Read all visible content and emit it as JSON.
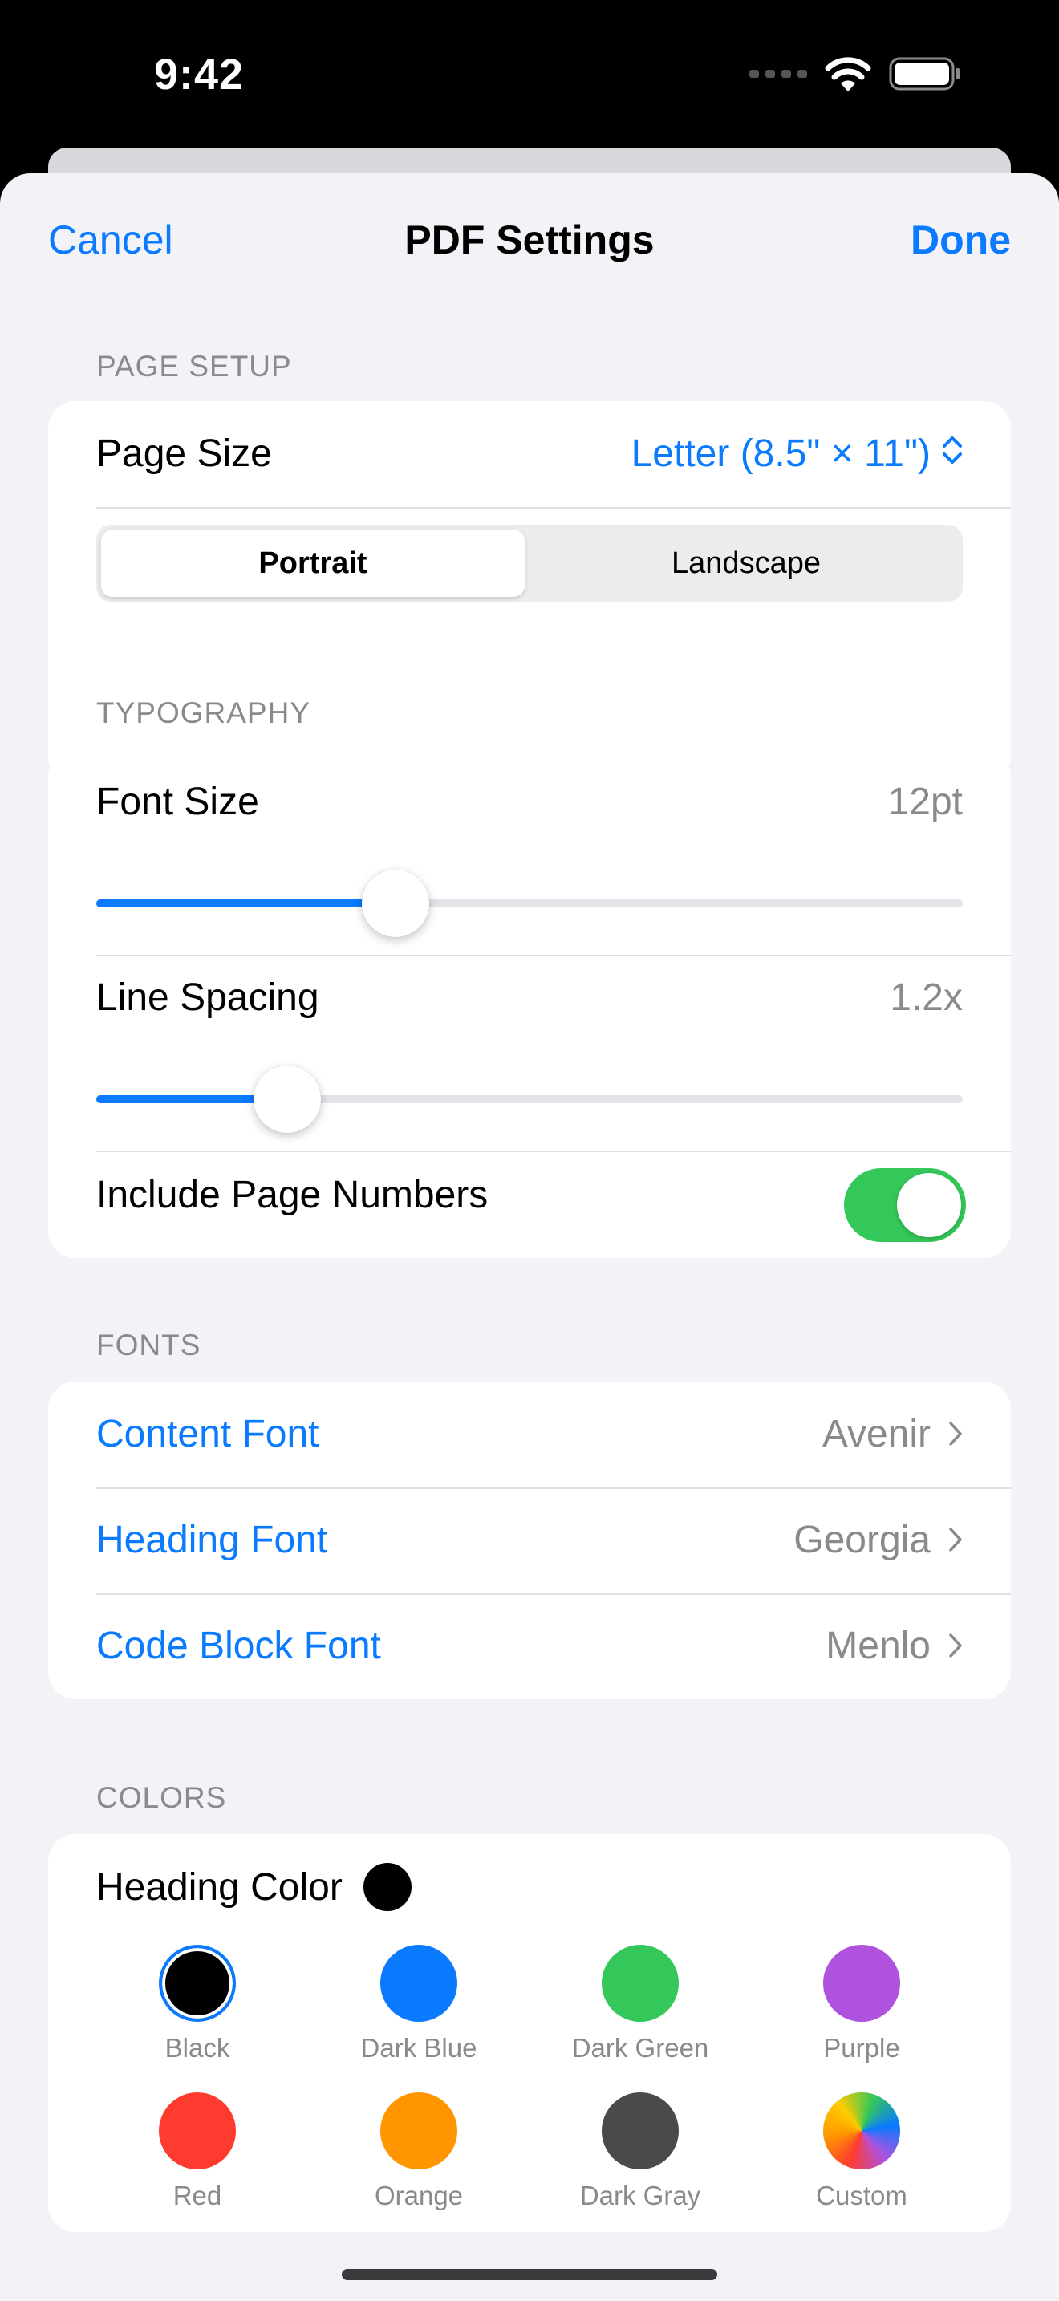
{
  "status_bar": {
    "time": "9:42"
  },
  "nav": {
    "cancel": "Cancel",
    "title": "PDF Settings",
    "done": "Done"
  },
  "page_setup": {
    "header": "PAGE SETUP",
    "page_size_label": "Page Size",
    "page_size_value": "Letter (8.5\" × 11\")",
    "orientation_options": [
      "Portrait",
      "Landscape"
    ],
    "selected_orientation": "Portrait"
  },
  "typography": {
    "header": "TYPOGRAPHY",
    "font_size_label": "Font Size",
    "font_size_value": "12pt",
    "font_size_fraction": 0.345,
    "line_spacing_label": "Line Spacing",
    "line_spacing_value": "1.2x",
    "line_spacing_fraction": 0.22,
    "page_numbers_label": "Include Page Numbers",
    "page_numbers_on": true
  },
  "fonts": {
    "header": "FONTS",
    "items": [
      {
        "label": "Content Font",
        "value": "Avenir"
      },
      {
        "label": "Heading Font",
        "value": "Georgia"
      },
      {
        "label": "Code Block Font",
        "value": "Menlo"
      }
    ]
  },
  "colors": {
    "header": "COLORS",
    "heading_color_label": "Heading Color",
    "current_color": "#000000",
    "selected": "Black",
    "options": [
      {
        "name": "Black",
        "color": "#000000"
      },
      {
        "name": "Dark Blue",
        "color": "#0a7aff"
      },
      {
        "name": "Dark Green",
        "color": "#34c759"
      },
      {
        "name": "Purple",
        "color": "#af52de"
      },
      {
        "name": "Red",
        "color": "#ff3b30"
      },
      {
        "name": "Orange",
        "color": "#ff9500"
      },
      {
        "name": "Dark Gray",
        "color": "#4a4a4a"
      },
      {
        "name": "Custom",
        "color": "conic-gradient"
      }
    ]
  },
  "theme": {
    "accent": "#0a7aff",
    "toggle_on": "#34c759",
    "secondary_text": "#8a8a8e"
  }
}
